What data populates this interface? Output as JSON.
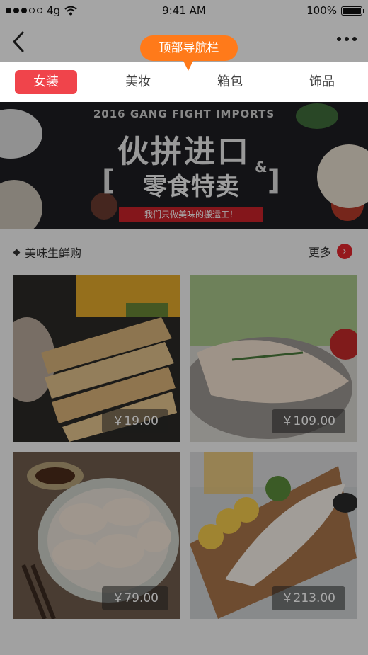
{
  "status_bar": {
    "carrier": "4g",
    "time": "9:41 AM",
    "battery": "100%"
  },
  "annotation": {
    "callout_label": "顶部导航栏"
  },
  "tabs": [
    {
      "label": "女装",
      "active": true
    },
    {
      "label": "美妆",
      "active": false
    },
    {
      "label": "箱包",
      "active": false
    },
    {
      "label": "饰品",
      "active": false
    }
  ],
  "banner": {
    "top_text": "2016 GANG FIGHT IMPORTS",
    "main_text": "伙拼进口",
    "amp": "&",
    "sub_text": "零食特卖",
    "slogan": "我们只做美味的搬运工！"
  },
  "section": {
    "title": "美味生鲜购",
    "more_label": "更多"
  },
  "products": [
    {
      "price": "￥19.00"
    },
    {
      "price": "￥109.00"
    },
    {
      "price": "￥79.00"
    },
    {
      "price": "￥213.00"
    }
  ],
  "colors": {
    "accent_red": "#f0444b",
    "callout_orange": "#ff7a1a"
  }
}
